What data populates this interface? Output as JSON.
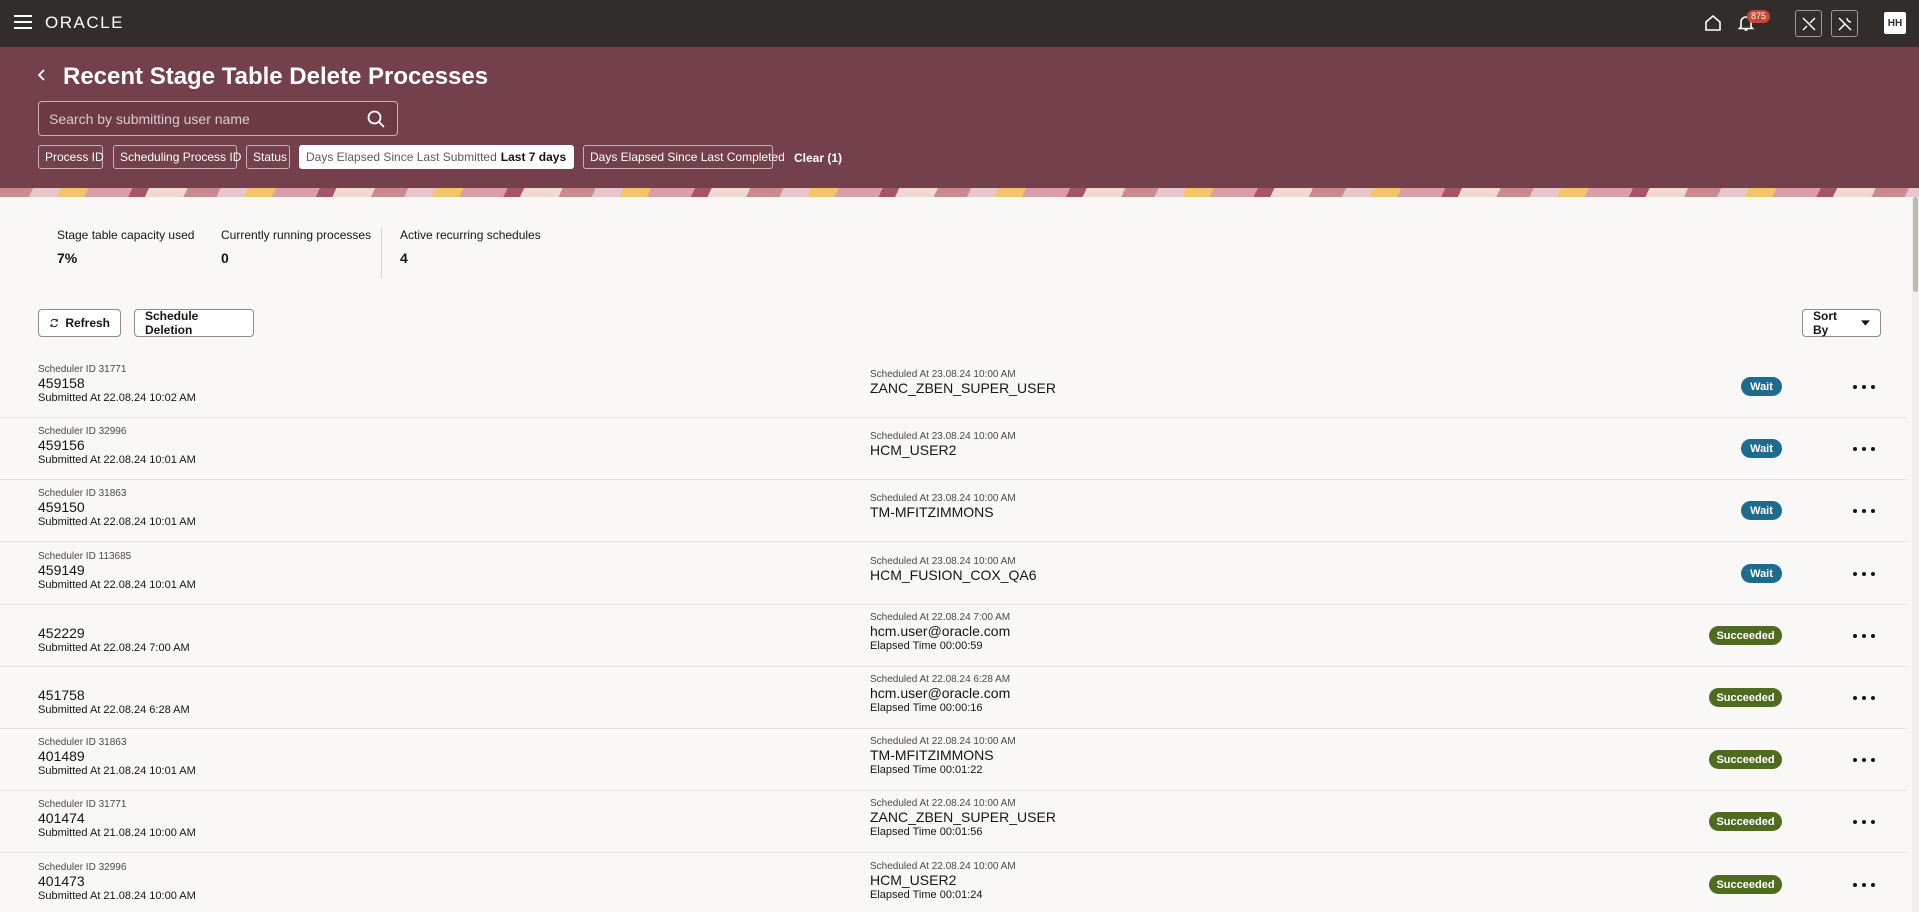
{
  "topbar": {
    "logo": "ORACLE",
    "notification_count": "875",
    "avatar_initials": "HH"
  },
  "header": {
    "title": "Recent Stage Table Delete Processes",
    "search_placeholder": "Search by submitting user name"
  },
  "filters": {
    "process_id": "Process ID",
    "scheduling_process_id": "Scheduling Process ID",
    "status": "Status",
    "days_submitted_label": "Days Elapsed Since Last Submitted",
    "days_submitted_value": "Last 7 days",
    "days_completed": "Days Elapsed Since Last Completed",
    "clear": "Clear (1)"
  },
  "metrics": {
    "capacity_label": "Stage table capacity used",
    "capacity_value": "7%",
    "running_label": "Currently running processes",
    "running_value": "0",
    "schedules_label": "Active recurring schedules",
    "schedules_value": "4"
  },
  "actions": {
    "refresh": "Refresh",
    "schedule": "Schedule Deletion",
    "sort_by": "Sort By"
  },
  "rows": [
    {
      "scheduler": "Scheduler ID 31771",
      "id": "459158",
      "submitted": "Submitted At 22.08.24 10:02 AM",
      "scheduled": "Scheduled At 23.08.24 10:00 AM",
      "user": "ZANC_ZBEN_SUPER_USER",
      "elapsed": "",
      "status": "Wait"
    },
    {
      "scheduler": "Scheduler ID 32996",
      "id": "459156",
      "submitted": "Submitted At 22.08.24 10:01 AM",
      "scheduled": "Scheduled At 23.08.24 10:00 AM",
      "user": "HCM_USER2",
      "elapsed": "",
      "status": "Wait"
    },
    {
      "scheduler": "Scheduler ID 31863",
      "id": "459150",
      "submitted": "Submitted At 22.08.24 10:01 AM",
      "scheduled": "Scheduled At 23.08.24 10:00 AM",
      "user": "TM-MFITZIMMONS",
      "elapsed": "",
      "status": "Wait"
    },
    {
      "scheduler": "Scheduler ID 113685",
      "id": "459149",
      "submitted": "Submitted At 22.08.24 10:01 AM",
      "scheduled": "Scheduled At 23.08.24 10:00 AM",
      "user": "HCM_FUSION_COX_QA6",
      "elapsed": "",
      "status": "Wait"
    },
    {
      "scheduler": "",
      "id": "452229",
      "submitted": "Submitted At 22.08.24 7:00 AM",
      "scheduled": "Scheduled At 22.08.24 7:00 AM",
      "user": "hcm.user@oracle.com",
      "elapsed": "Elapsed Time 00:00:59",
      "status": "Succeeded"
    },
    {
      "scheduler": "",
      "id": "451758",
      "submitted": "Submitted At 22.08.24 6:28 AM",
      "scheduled": "Scheduled At 22.08.24 6:28 AM",
      "user": "hcm.user@oracle.com",
      "elapsed": "Elapsed Time 00:00:16",
      "status": "Succeeded"
    },
    {
      "scheduler": "Scheduler ID 31863",
      "id": "401489",
      "submitted": "Submitted At 21.08.24 10:01 AM",
      "scheduled": "Scheduled At 22.08.24 10:00 AM",
      "user": "TM-MFITZIMMONS",
      "elapsed": "Elapsed Time 00:01:22",
      "status": "Succeeded"
    },
    {
      "scheduler": "Scheduler ID 31771",
      "id": "401474",
      "submitted": "Submitted At 21.08.24 10:00 AM",
      "scheduled": "Scheduled At 22.08.24 10:00 AM",
      "user": "ZANC_ZBEN_SUPER_USER",
      "elapsed": "Elapsed Time 00:01:56",
      "status": "Succeeded"
    },
    {
      "scheduler": "Scheduler ID 32996",
      "id": "401473",
      "submitted": "Submitted At 21.08.24 10:00 AM",
      "scheduled": "Scheduled At 22.08.24 10:00 AM",
      "user": "HCM_USER2",
      "elapsed": "Elapsed Time 00:01:24",
      "status": "Succeeded"
    }
  ]
}
